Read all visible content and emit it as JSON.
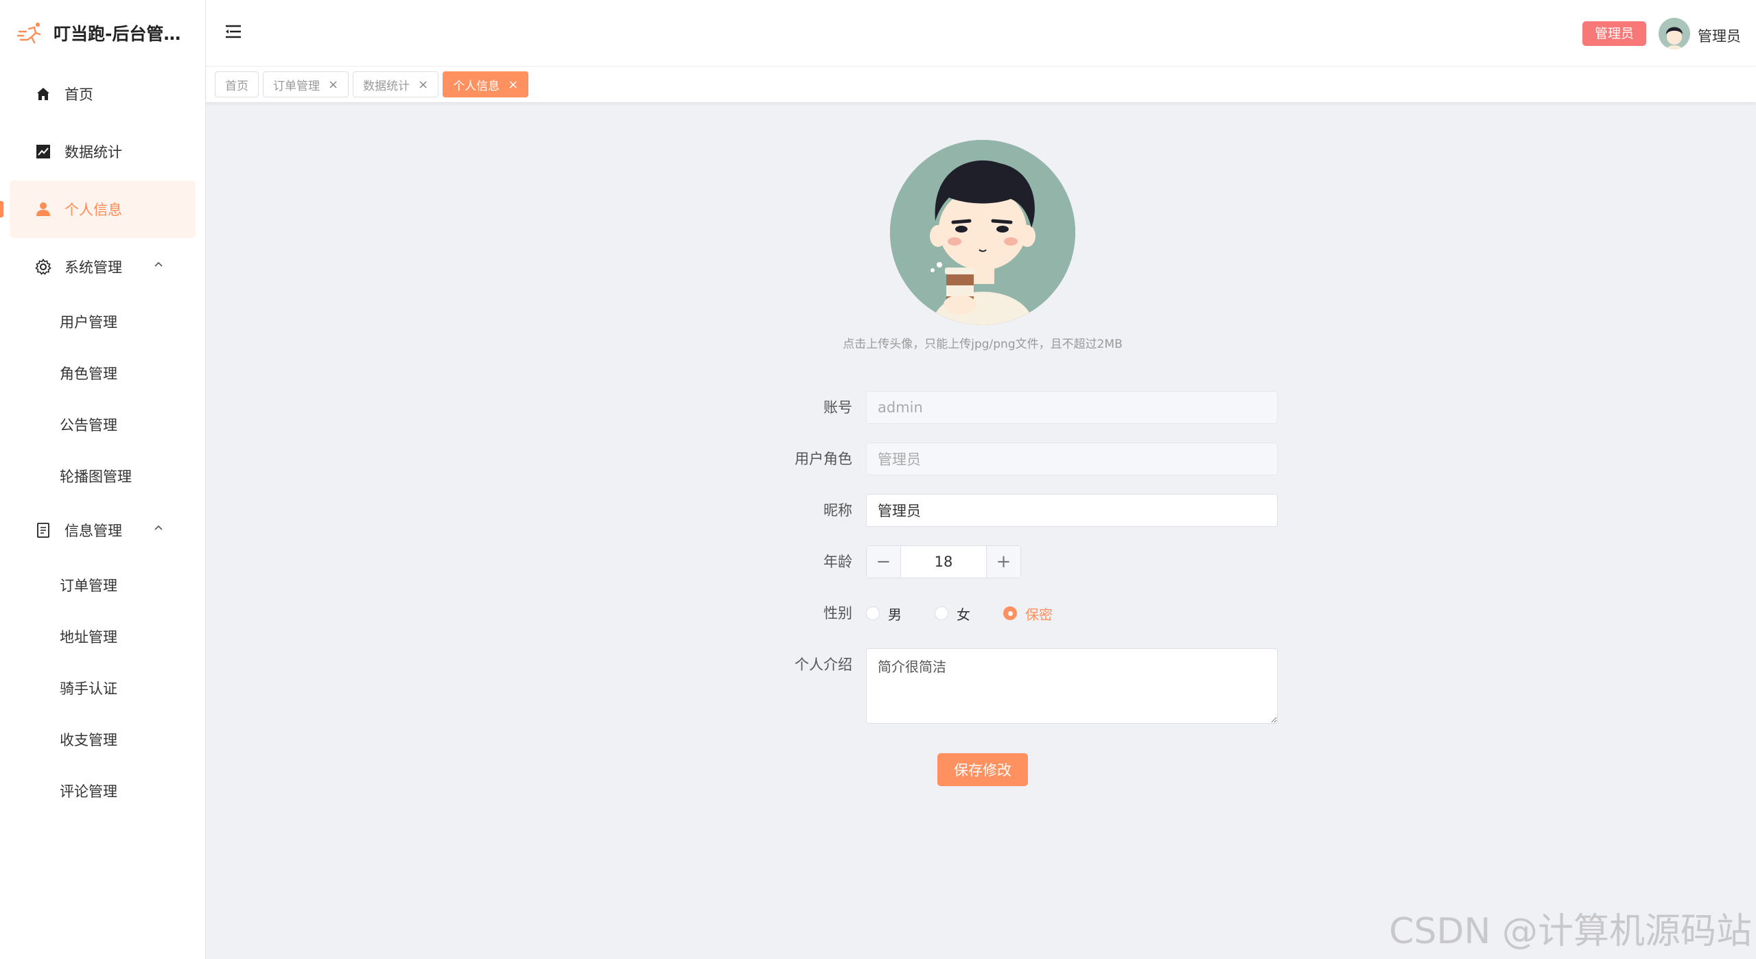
{
  "app": {
    "title": "叮当跑-后台管…"
  },
  "sidebar": {
    "items": [
      {
        "label": "首页",
        "icon": "home-icon"
      },
      {
        "label": "数据统计",
        "icon": "chart-icon"
      },
      {
        "label": "个人信息",
        "icon": "user-icon",
        "active": true
      },
      {
        "label": "系统管理",
        "icon": "gear-icon",
        "children": [
          "用户管理",
          "角色管理",
          "公告管理",
          "轮播图管理"
        ]
      },
      {
        "label": "信息管理",
        "icon": "document-icon",
        "children": [
          "订单管理",
          "地址管理",
          "骑手认证",
          "收支管理",
          "评论管理"
        ]
      }
    ]
  },
  "header": {
    "role_badge": "管理员",
    "username": "管理员"
  },
  "tags": [
    {
      "label": "首页",
      "closable": false
    },
    {
      "label": "订单管理",
      "closable": true
    },
    {
      "label": "数据统计",
      "closable": true
    },
    {
      "label": "个人信息",
      "closable": true,
      "active": true
    }
  ],
  "profile": {
    "upload_tip": "点击上传头像，只能上传jpg/png文件，且不超过2MB",
    "fields": {
      "account": {
        "label": "账号",
        "value": "admin"
      },
      "role": {
        "label": "用户角色",
        "value": "管理员"
      },
      "nickname": {
        "label": "昵称",
        "value": "管理员"
      },
      "age": {
        "label": "年龄",
        "value": "18"
      },
      "gender": {
        "label": "性别",
        "options": [
          "男",
          "女",
          "保密"
        ],
        "selected": "保密"
      },
      "intro": {
        "label": "个人介绍",
        "value": "简介很简洁"
      }
    },
    "save_label": "保存修改"
  },
  "watermark": "CSDN @计算机源码站",
  "colors": {
    "accent": "#ff9060",
    "badge": "#f87878"
  }
}
